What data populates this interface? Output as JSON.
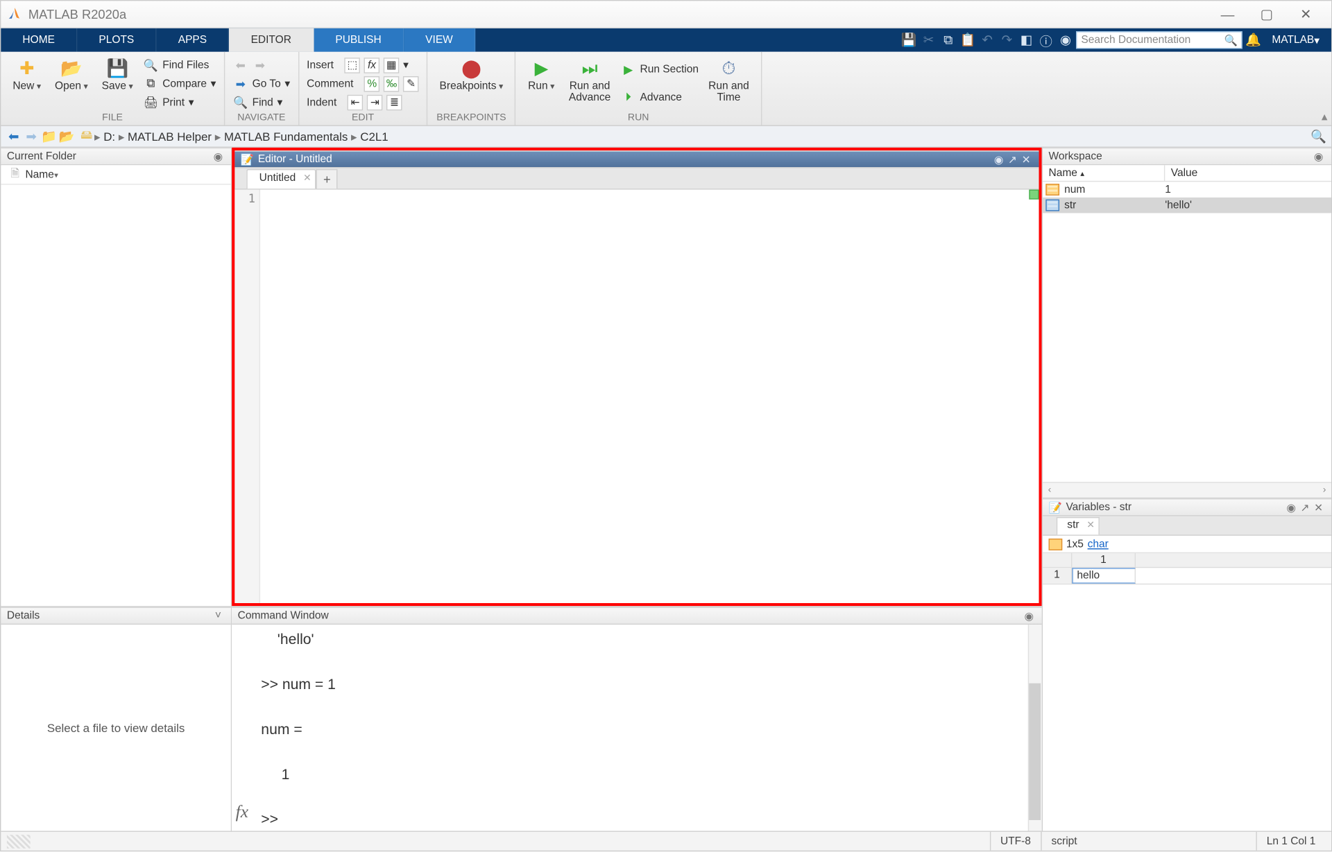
{
  "window": {
    "title": "MATLAB R2020a"
  },
  "tabs": {
    "home": "HOME",
    "plots": "PLOTS",
    "apps": "APPS",
    "editor": "EDITOR",
    "publish": "PUBLISH",
    "view": "VIEW"
  },
  "tbr": {
    "search_placeholder": "Search Documentation",
    "user": "MATLAB"
  },
  "ribbon": {
    "new": "New",
    "open": "Open",
    "save": "Save",
    "findfiles": "Find Files",
    "compare": "Compare",
    "print": "Print",
    "file_label": "FILE",
    "goto": "Go To",
    "find": "Find",
    "nav_label": "NAVIGATE",
    "insert": "Insert",
    "comment": "Comment",
    "indent": "Indent",
    "edit_label": "EDIT",
    "breakpoints": "Breakpoints",
    "bp_label": "BREAKPOINTS",
    "run": "Run",
    "runadv": "Run and\nAdvance",
    "runsec": "Run Section",
    "advance": "Advance",
    "runtime": "Run and\nTime",
    "run_label": "RUN"
  },
  "path": {
    "drive": "D:",
    "p1": "MATLAB Helper",
    "p2": "MATLAB Fundamentals",
    "p3": "C2L1"
  },
  "panels": {
    "current_folder": "Current Folder",
    "name_col": "Name",
    "details": "Details",
    "details_msg": "Select a file to view details",
    "editor": "Editor - Untitled",
    "ed_tab": "Untitled",
    "line1": "1",
    "cmdwin": "Command Window",
    "workspace": "Workspace",
    "ws_name": "Name",
    "ws_value": "Value",
    "variables": "Variables - str",
    "var_tab": "str"
  },
  "workspace": {
    "rows": [
      {
        "name": "num",
        "value": "1"
      },
      {
        "name": "str",
        "value": "'hello'"
      }
    ]
  },
  "cmd": {
    "l1": "    'hello'",
    "l2": ">> num = 1",
    "l3": "num =",
    "l4": "     1",
    "prompt": ">> "
  },
  "var": {
    "dims": "1x5",
    "type": "char",
    "colhdr": "1",
    "rowhdr": "1",
    "cell": "hello"
  },
  "status": {
    "enc": "UTF-8",
    "type": "script",
    "pos": "Ln  1   Col  1"
  }
}
